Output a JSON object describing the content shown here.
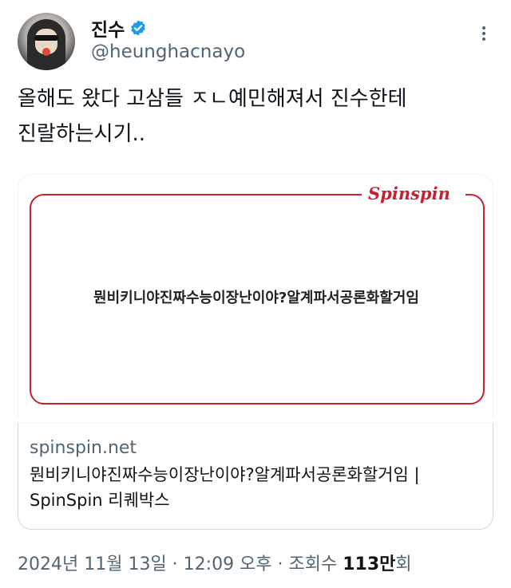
{
  "author": {
    "display_name": "진수",
    "handle": "@heunghacnayo",
    "verified": true
  },
  "tweet": {
    "line1": "올해도 왔다 고삼들 ㅈㄴ예민해져서 진수한테",
    "line2": "진랄하는시기.."
  },
  "card": {
    "logo_text": "Spinspin",
    "question": "뭔비키니야진짜수능이장난이야?알계파서공론화할거임",
    "domain": "spinspin.net",
    "title_line1": "뭔비키니야진짜수능이장난이야?알계파서공론화할거임 |",
    "title_line2": "SpinSpin 리퀘박스"
  },
  "meta": {
    "timestamp": "2024년 11월 13일 · 12:09 오후 · 조회수 ",
    "views_number": "113만",
    "views_suffix": "회"
  },
  "colors": {
    "brand_red": "#c8202f",
    "verified_blue": "#1d9bf0",
    "secondary_text": "#536471"
  },
  "icons": {
    "verified": "verified-badge-icon",
    "more": "more-options-icon"
  }
}
